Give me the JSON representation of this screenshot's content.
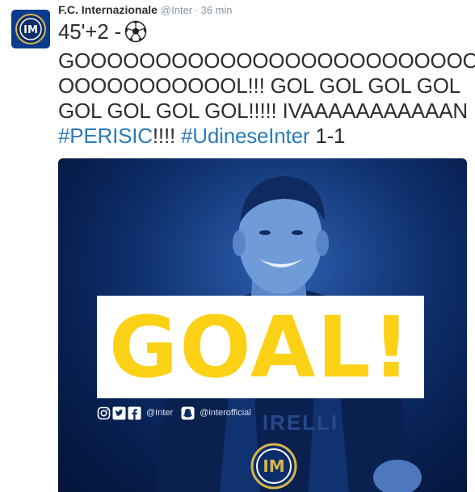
{
  "author": {
    "name": "F.C. Internazionale",
    "handle": "@Inter",
    "separator": "·",
    "time": "36 min",
    "avatar_icon": "inter-crest-icon"
  },
  "tweet": {
    "line1_prefix": "45'+2 -",
    "line1_icon": "soccer-ball-icon",
    "line2": "GOOOOOOOOOOOOOOOOOOOOOOOOO",
    "line3": "OOOOOOOOOOOL!!! GOL GOL GOL GOL",
    "line4": "GOL GOL GOL GOL!!!!! IVAAAAAAAAAAAN",
    "hashtag1": "#PERISIC",
    "after_hashtag1": "!!!! ",
    "hashtag2": "#UdineseInter",
    "after_hashtag2": " 1-1",
    "hashtag_color": "#2b7bb9"
  },
  "media": {
    "goal_label": "GOAL!",
    "goal_color": "#fcd116",
    "social_handles": {
      "inter": "@Inter",
      "official": "@interofficial"
    },
    "icons": [
      "instagram-icon",
      "twitter-icon",
      "facebook-icon",
      "snapchat-icon",
      "inter-crest-icon"
    ],
    "background_color": "#0c2d6b"
  }
}
